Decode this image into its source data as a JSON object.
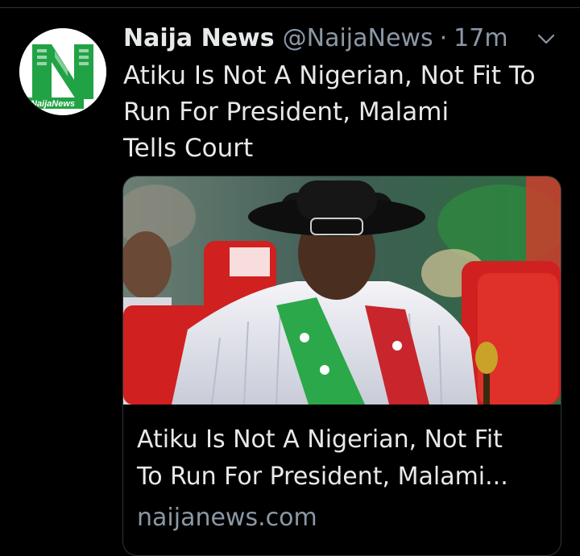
{
  "tweet": {
    "display_name": "Naija News",
    "handle": "@NaijaNews",
    "separator": "·",
    "time": "17m",
    "text": "Atiku Is Not A Nigerian, Not Fit To\nRun For President, Malami\nTells   Court",
    "avatar": {
      "logo_text": "NaijaNews",
      "brand_green": "#21a345"
    }
  },
  "card": {
    "image": {
      "description_icon": "news-photo",
      "colors": {
        "seat_red": "#d0201f",
        "sash_green": "#2aa84a",
        "sash_red": "#c8262c"
      }
    },
    "title_lines": [
      "Atiku Is Not A Nigerian, Not Fit",
      "To Run For President, Malami..."
    ],
    "domain": "naijanews.com"
  },
  "icons": {
    "more": "chevron-down-icon"
  }
}
